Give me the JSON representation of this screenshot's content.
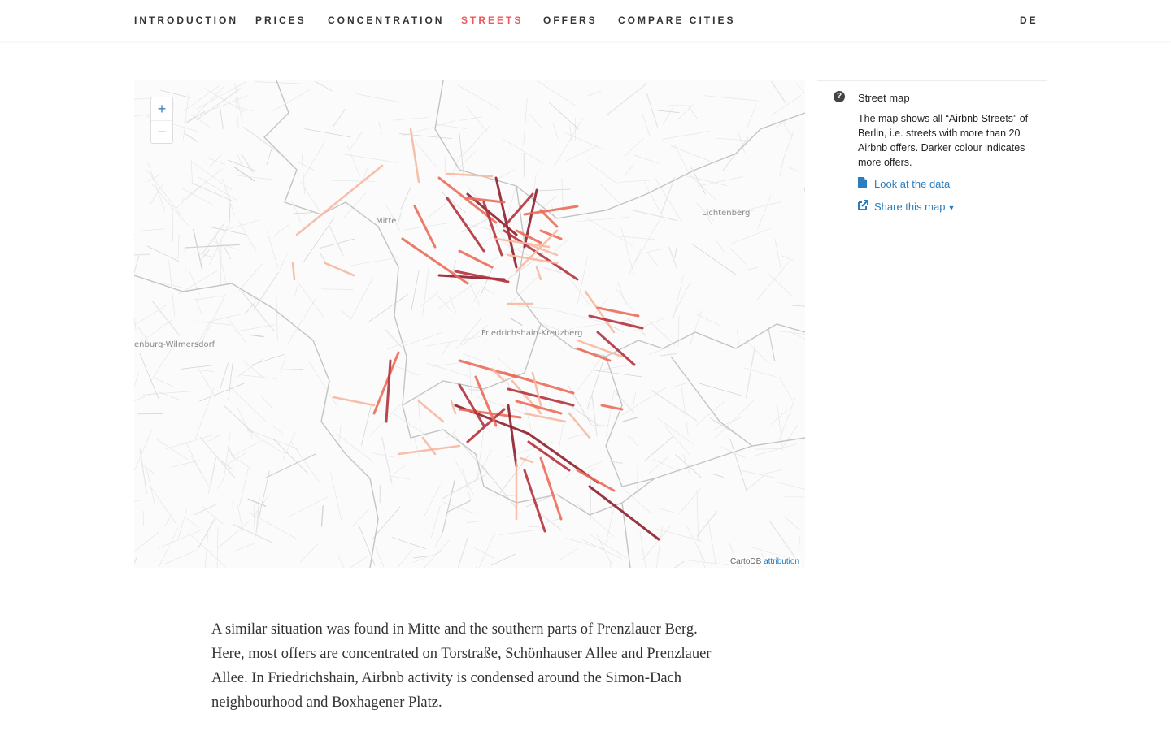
{
  "nav": {
    "items": [
      {
        "label": "INTRODUCTION",
        "active": false
      },
      {
        "label": "PRICES",
        "active": false
      },
      {
        "label": "CONCENTRATION",
        "active": false
      },
      {
        "label": "STREETS",
        "active": true
      },
      {
        "label": "OFFERS",
        "active": false
      },
      {
        "label": "COMPARE CITIES",
        "active": false
      }
    ],
    "language": "DE",
    "active_color": "#f0565a"
  },
  "map": {
    "zoom_in": "+",
    "zoom_out": "−",
    "labels": {
      "mitte": "Mitte",
      "lichtenberg": "Lichtenberg",
      "friedrichshain_kreuzberg": "Friedrichshain-Kreuzberg",
      "charlottenburg": "enburg-Wilmersdorf"
    },
    "attribution_prefix": "CartoDB",
    "attribution_link": "attribution",
    "street_colors": {
      "light": "#f7b79e",
      "medium": "#ec6b5a",
      "dark": "#b2323c",
      "darkest": "#8e1f2c"
    }
  },
  "info": {
    "icon": "question-circle-icon",
    "title": "Street map",
    "text": "The map shows all “Airbnb Streets” of Berlin, i.e. streets with more than 20 Airbnb offers. Darker colour indicates more offers.",
    "data_link": "Look at the data",
    "share_link": "Share this map",
    "link_color": "#2a7ec0"
  },
  "body_text": "A similar situation was found in Mitte and the southern parts of Prenzlauer Berg. Here, most offers are concentrated on Torstraße, Schönhauser Allee and Prenzlauer Allee. In Friedrichshain, Airbnb activity is condensed around the Simon-Dach neighbourhood and Boxhagener Platz."
}
